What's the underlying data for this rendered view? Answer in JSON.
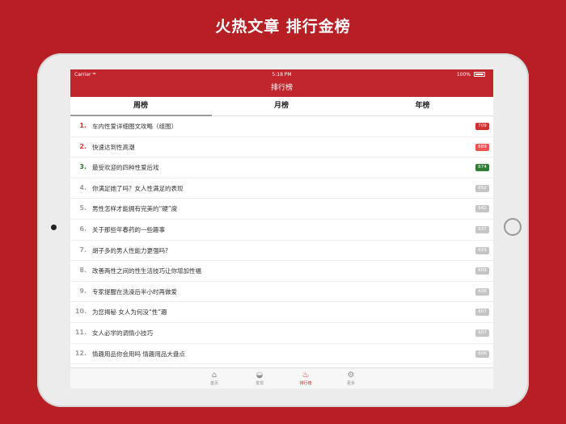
{
  "headline": "火热文章 排行金榜",
  "status_bar": {
    "carrier": "Carrier",
    "wifi_icon": "wifi-icon",
    "time": "5:18 PM",
    "battery": "100%"
  },
  "nav_title": "排行榜",
  "tabs": [
    "周榜",
    "月榜",
    "年榜"
  ],
  "selected_tab": "周榜",
  "articles": [
    {
      "rank": "1.",
      "title": "车内性爱详细图文攻略（组图）",
      "count": "709"
    },
    {
      "rank": "2.",
      "title": "快速达到性高潮",
      "count": "689"
    },
    {
      "rank": "3.",
      "title": "最受欢迎的四种性爱后戏",
      "count": "674"
    },
    {
      "rank": "4.",
      "title": "你满足她了吗？女人性满足的表现",
      "count": "652"
    },
    {
      "rank": "5.",
      "title": "男性怎样才能拥有完美的“硬”度",
      "count": "642"
    },
    {
      "rank": "6.",
      "title": "关于那些年春药的一些趣事",
      "count": "637"
    },
    {
      "rank": "7.",
      "title": "胡子多的男人性能力更强吗?",
      "count": "619"
    },
    {
      "rank": "8.",
      "title": "改善两性之间的性生活技巧让你增加性福",
      "count": "609"
    },
    {
      "rank": "9.",
      "title": "专家提醒在洗澡后半小时再做爱",
      "count": "608"
    },
    {
      "rank": "10.",
      "title": "为您揭秘 女人为何没“性”趣",
      "count": "607"
    },
    {
      "rank": "11.",
      "title": "女人必学的调情小技巧",
      "count": "607"
    },
    {
      "rank": "12.",
      "title": "情趣用品你会用吗 情趣用品大盘点",
      "count": "606"
    }
  ],
  "tabbar": [
    {
      "label": "首页",
      "icon": "home-icon",
      "glyph": "⌂"
    },
    {
      "label": "发现",
      "icon": "discover-icon",
      "glyph": "◒"
    },
    {
      "label": "排行榜",
      "icon": "flame-icon",
      "glyph": "♨"
    },
    {
      "label": "更多",
      "icon": "settings-icon",
      "glyph": "⚙"
    }
  ],
  "tabbar_selected": "排行榜",
  "colors": {
    "brand_red": "#b71f24",
    "bar_red": "#c0262c",
    "rank1": "#d32f2f",
    "rank3_green": "#2e7d32",
    "badge_gray": "#c5c5c5"
  }
}
